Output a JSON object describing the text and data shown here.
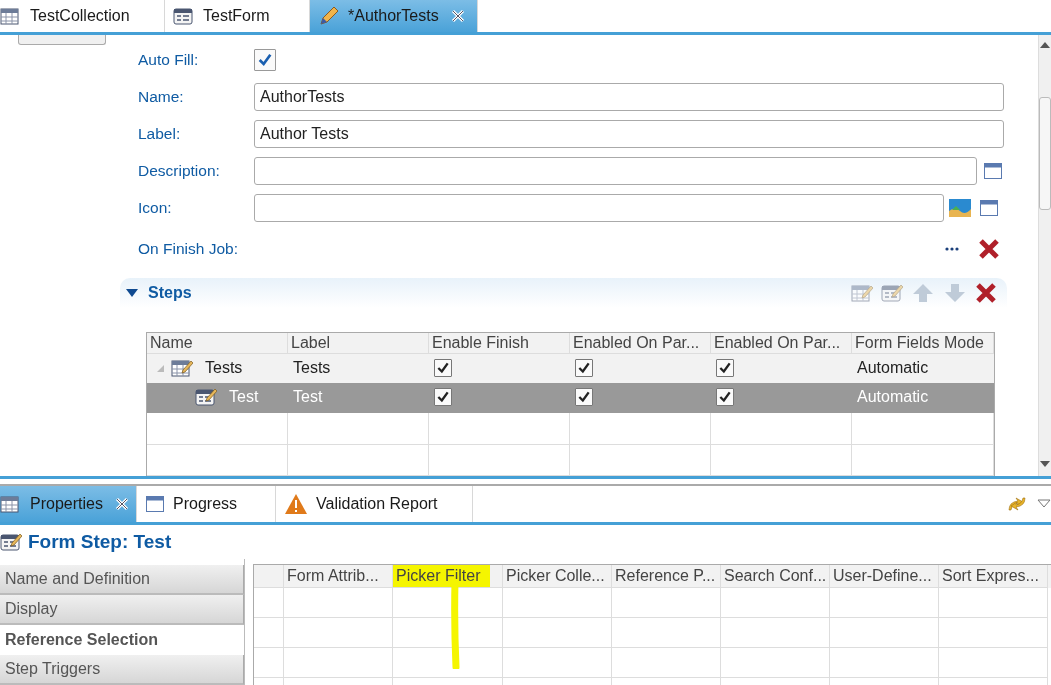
{
  "editor_tabs": [
    {
      "label": "TestCollection",
      "selected": false,
      "closable": false
    },
    {
      "label": "TestForm",
      "selected": false,
      "closable": false
    },
    {
      "label": "*AuthorTests",
      "selected": true,
      "closable": true
    }
  ],
  "form": {
    "auto_fill": {
      "label": "Auto Fill:",
      "checked": true
    },
    "fields": [
      {
        "label": "Name:",
        "value": "AuthorTests",
        "kind": "text"
      },
      {
        "label": "Label:",
        "value": "Author Tests",
        "kind": "text"
      },
      {
        "label": "Description:",
        "kind": "text_dialog"
      },
      {
        "label": "Icon:",
        "kind": "image_dialog"
      },
      {
        "label": "On Finish Job:",
        "kind": "job"
      }
    ]
  },
  "steps": {
    "title": "Steps",
    "expanded": true,
    "columns": [
      "Name",
      "Label",
      "Enable Finish",
      "Enabled On Par...",
      "Enabled On Par...",
      "Form Fields Mode"
    ],
    "rows": [
      {
        "name": "Tests",
        "label": "Tests",
        "checks": [
          true,
          true,
          true
        ],
        "mode": "Automatic",
        "selected": false,
        "expanded": true,
        "children": [
          {
            "name": "Test",
            "label": "Test",
            "checks": [
              true,
              true,
              true
            ],
            "mode": "Automatic",
            "selected": true
          }
        ]
      }
    ]
  },
  "bottom_tabs": [
    {
      "label": "Properties",
      "selected": true,
      "closable": true
    },
    {
      "label": "Progress",
      "selected": false,
      "closable": false
    },
    {
      "label": "Validation Report",
      "selected": false,
      "closable": false
    }
  ],
  "properties": {
    "title": "Form Step: Test",
    "sections": [
      {
        "label": "Name and Definition",
        "selected": false
      },
      {
        "label": "Display",
        "selected": false
      },
      {
        "label": "Reference Selection",
        "selected": true
      },
      {
        "label": "Step Triggers",
        "selected": false
      }
    ],
    "columns": [
      {
        "label": "Form Attrib...",
        "highlighted": false
      },
      {
        "label": "Picker Filter",
        "highlighted": true
      },
      {
        "label": "Picker Colle...",
        "highlighted": false
      },
      {
        "label": "Reference P...",
        "highlighted": false
      },
      {
        "label": "Search Conf...",
        "highlighted": false
      },
      {
        "label": "User-Define...",
        "highlighted": false
      },
      {
        "label": "Sort Expres...",
        "highlighted": false
      }
    ]
  }
}
